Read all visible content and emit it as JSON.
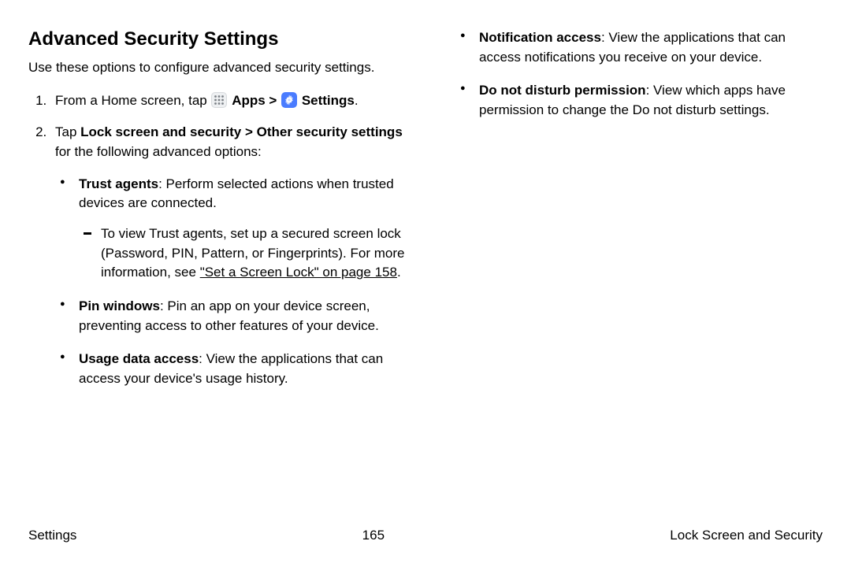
{
  "heading": "Advanced Security Settings",
  "intro": "Use these options to configure advanced security settings.",
  "step1": {
    "prefix": "From a Home screen, tap ",
    "apps": "Apps",
    "gt": " > ",
    "settings": "Settings",
    "suffix": "."
  },
  "step2": {
    "prefix": "Tap ",
    "bold": "Lock screen and security > Other security settings",
    "suffix": " for the following advanced options:"
  },
  "bullets_left": {
    "trust": {
      "label": "Trust agents",
      "text": ": Perform selected actions when trusted devices are connected."
    },
    "trust_sub": {
      "prefix": "To view Trust agents, set up a secured screen lock (Password, PIN, Pattern, or Fingerprints). For more information, see ",
      "link": "\"Set a Screen Lock\" on page 158",
      "suffix": "."
    },
    "pin": {
      "label": "Pin windows",
      "text": ": Pin an app on your device screen, preventing access to other features of your device."
    },
    "usage": {
      "label": "Usage data access",
      "text": ": View the applications that can access your device's usage history."
    }
  },
  "bullets_right": {
    "notif": {
      "label": "Notification access",
      "text": ": View the applications that can access notifications you receive on your device."
    },
    "dnd": {
      "label": "Do not disturb permission",
      "text": ": View which apps have permission to change the Do not disturb settings."
    }
  },
  "footer": {
    "left": "Settings",
    "center": "165",
    "right": "Lock Screen and Security"
  }
}
